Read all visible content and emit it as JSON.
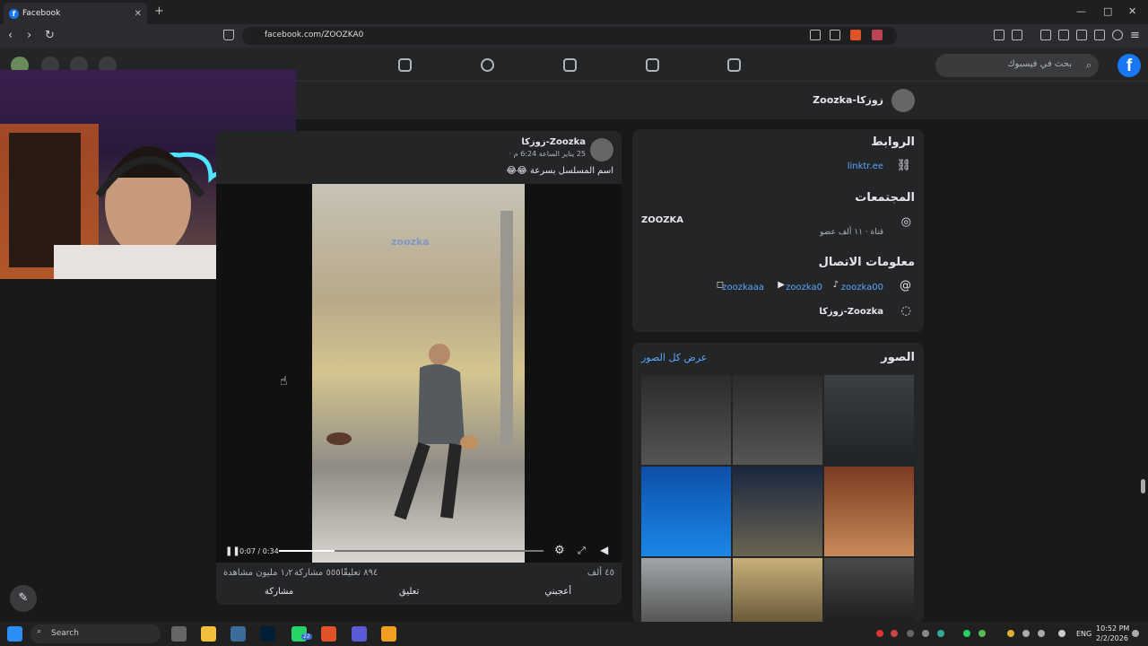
{
  "browser": {
    "tab_title": "Facebook",
    "new_tab": "+",
    "url": "facebook.com/ZOOZKA0",
    "minimize": "—",
    "maximize": "□",
    "close": "✕"
  },
  "fb": {
    "search_placeholder": "بحث في فيسبوك",
    "logo": "f",
    "page_name": "Zoozka-زوزكا"
  },
  "links_panel": {
    "title": "الروابط",
    "link": "linktr.ee",
    "communities_title": "المجتمعات",
    "community_name": "ZOOZKA",
    "community_meta": "قناة · ١١ ألف عضو",
    "contact_title": "معلومات الاتصال",
    "instagram": "zoozkaaa",
    "youtube": "zoozka0",
    "tiktok": "zoozka00",
    "messenger": "Zoozka-زوزكا"
  },
  "photos_panel": {
    "title": "الصور",
    "see_all": "عرض كل الصور"
  },
  "post": {
    "author": "Zoozka-زوزكا",
    "time": "25 يناير الساعة 6:24 م ·",
    "caption": "اسم المسلسل بسرعة 😂😂",
    "watermark": "zoozka",
    "video_time": "0:07 / 0:34",
    "progress": 0.21,
    "reactions": "٤٥ ألف",
    "comments_count": "٨٩٤ تعليقًا",
    "shares_count": "٥٥٥ مشاركة",
    "views": "١٫٢ مليون مشاهدة",
    "like_btn": "أعجبني",
    "comment_btn": "تعليق",
    "share_btn": "مشاركة"
  },
  "taskbar": {
    "search": "Search",
    "lang": "ENG",
    "time": "10:52 PM",
    "date": "2/2/2026",
    "whatsapp_badge": "22"
  },
  "colors": {
    "fb_blue": "#1877f2",
    "link_blue": "#5aa7ff",
    "panel": "#242526",
    "background": "#18191a"
  }
}
